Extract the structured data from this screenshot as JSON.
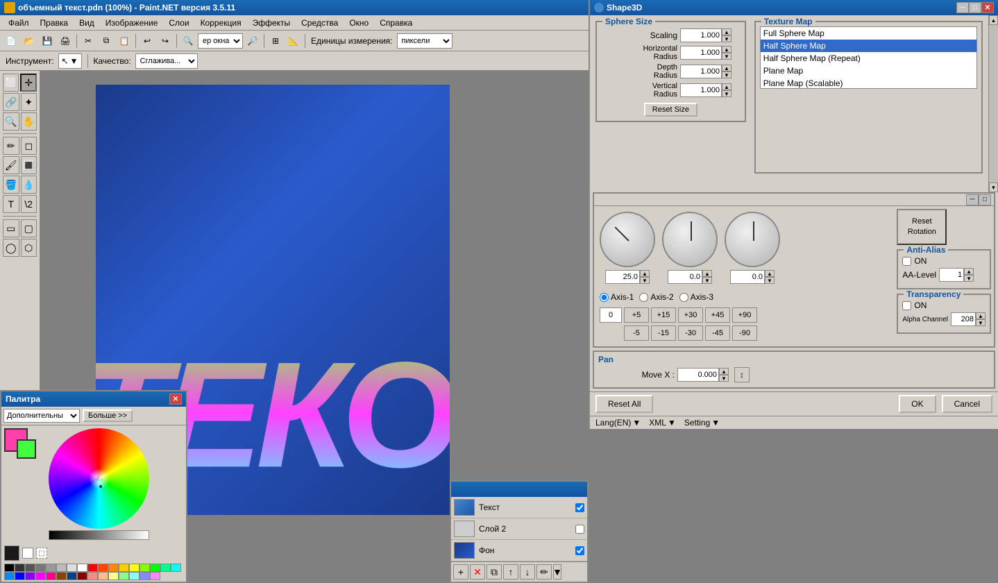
{
  "titleBar": {
    "title": "объемный текст.pdn (100%) - Paint.NET версия 3.5.11",
    "closeBtn": "✕",
    "minBtn": "─",
    "maxBtn": "□"
  },
  "menuBar": {
    "items": [
      "Файл",
      "Правка",
      "Вид",
      "Изображение",
      "Слои",
      "Коррекция",
      "Эффекты",
      "Средства",
      "Окно",
      "Справка"
    ]
  },
  "toolbar": {
    "unitLabel": "Единицы измерения:",
    "unitValue": "пиксели"
  },
  "toolOptions": {
    "toolLabel": "Инструмент:",
    "qualityLabel": "Качество:",
    "qualityValue": "Сглажива..."
  },
  "shape3d": {
    "title": "Shape3D",
    "sphereSize": {
      "title": "Sphere Size",
      "scaling": "Scaling",
      "scalingValue": "1.000",
      "horizontalRadius": "Horizontal Radius",
      "horizontalValue": "1.000",
      "depthRadius": "Depth Radius",
      "depthValue": "1.000",
      "verticalRadius": "Vertical Radius",
      "verticalValue": "1.000",
      "resetSizeBtn": "Reset Size"
    },
    "textureMap": {
      "title": "Texture Map",
      "items": [
        "Full Sphere Map",
        "Half Sphere Map",
        "Half Sphere Map (Repeat)",
        "Plane Map",
        "Plane Map (Scalable)"
      ],
      "selected": "Half Sphere Map"
    },
    "rotation": {
      "axis1Label": "Axis-1",
      "axis2Label": "Axis-2",
      "axis3Label": "Axis-3",
      "dial1Value": "25.0",
      "dial2Value": "0.0",
      "dial3Value": "0.0",
      "zeroBtn": "0",
      "stepBtns": [
        "+5",
        "+15",
        "+30",
        "+45",
        "+90",
        "-5",
        "-15",
        "-30",
        "-45",
        "-90"
      ],
      "resetRotationBtn": "Reset\nRotation"
    },
    "antiAlias": {
      "title": "Anti-Alias",
      "onLabel": "ON",
      "aaLevelLabel": "AA-Level",
      "aaLevelValue": "1"
    },
    "transparency": {
      "title": "Transparency",
      "onLabel": "ON",
      "alphaChannelLabel": "Alpha Channel",
      "alphaValue": "208"
    },
    "pan": {
      "title": "Pan",
      "movexLabel": "Move X :",
      "movexValue": "0.000"
    },
    "buttons": {
      "resetAll": "Reset All",
      "ok": "OK",
      "cancel": "Cancel"
    },
    "langBar": {
      "lang": "Lang(EN)",
      "xml": "XML",
      "setting": "Setting"
    }
  },
  "palette": {
    "title": "Палитра",
    "closeBtn": "✕",
    "modeLabel": "Дополнительны",
    "moreBtn": "Больше >>",
    "primaryColor": "#ff40aa",
    "secondaryColor": "#40ff40",
    "colors": [
      "#000000",
      "#333333",
      "#555555",
      "#777777",
      "#999999",
      "#bbbbbb",
      "#dddddd",
      "#ffffff",
      "#ff0000",
      "#ff4400",
      "#ff8800",
      "#ffcc00",
      "#ffff00",
      "#88ff00",
      "#00ff00",
      "#00ff88",
      "#00ffff",
      "#0088ff",
      "#0000ff",
      "#8800ff",
      "#ff00ff",
      "#ff0088",
      "#884400",
      "#004488",
      "#880000",
      "#ff8888",
      "#ffbb88",
      "#ffff88",
      "#88ff88",
      "#88ffff",
      "#8888ff",
      "#ff88ff"
    ]
  },
  "layers": {
    "items": [
      {
        "name": "Текст",
        "checked": true,
        "bg": "#4488cc"
      },
      {
        "name": "Слой 2",
        "checked": false,
        "bg": "#cccccc"
      },
      {
        "name": "Фон",
        "checked": true,
        "bg": "#1a3a8a"
      }
    ]
  }
}
